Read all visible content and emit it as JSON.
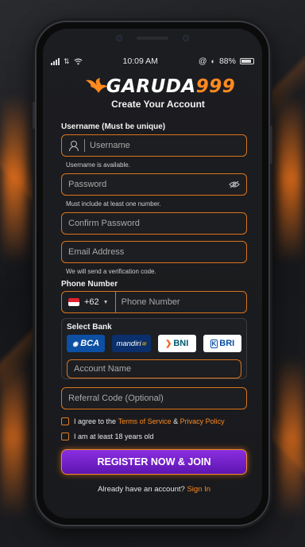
{
  "status_bar": {
    "time": "10:09 AM",
    "battery": "88%"
  },
  "brand": {
    "name": "GARUDA",
    "number": "999",
    "subtitle": "Create Your Account"
  },
  "colors": {
    "accent": "#ff8a1f",
    "button": "#7a24d0",
    "background": "#1c1d20"
  },
  "form": {
    "username": {
      "label": "Username (Must be unique)",
      "placeholder": "Username",
      "hint": "Username is available."
    },
    "password": {
      "placeholder": "Password",
      "hint": "Must include at least one number."
    },
    "confirm_password": {
      "placeholder": "Confirm Password"
    },
    "email": {
      "placeholder": "Email Address",
      "hint": "We will send a verification code."
    },
    "phone": {
      "label": "Phone Number",
      "country_code": "+62",
      "placeholder": "Phone Number"
    },
    "bank": {
      "label": "Select Bank",
      "options": [
        "BCA",
        "mandiri",
        "BNI",
        "BRI"
      ],
      "account_placeholder": "Account Name"
    },
    "referral": {
      "placeholder": "Referral Code (Optional)"
    },
    "terms": {
      "prefix": "I agree to the ",
      "tos": "Terms of Service",
      "amp": " & ",
      "privacy": "Privacy Policy"
    },
    "age": {
      "label": "I am at least 18 years old"
    },
    "submit": "REGISTER NOW & JOIN",
    "signin": {
      "prefix": "Already have an account? ",
      "link": "Sign In"
    }
  }
}
